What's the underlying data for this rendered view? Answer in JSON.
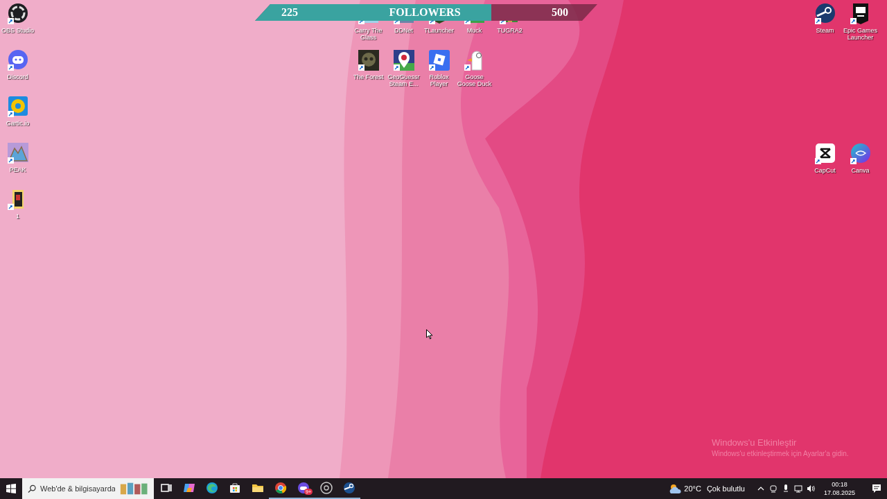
{
  "desktop": {
    "left_column": [
      {
        "kind": "obs",
        "label": "OBS Studio"
      },
      {
        "kind": "discord",
        "label": "Discord"
      },
      {
        "kind": "gartic",
        "label": "Gartic.io"
      },
      {
        "kind": "peak",
        "label": "PEAK"
      },
      {
        "kind": "folder",
        "label": "1"
      }
    ],
    "top_cluster": [
      {
        "kind": "carry",
        "label": "Carry The Glass"
      },
      {
        "kind": "ddnet",
        "label": "DDNet"
      },
      {
        "kind": "tlauncher",
        "label": "TLauncher"
      },
      {
        "kind": "muck",
        "label": "Muck"
      },
      {
        "kind": "winrar",
        "label": "TUGRA2"
      },
      {
        "kind": "forest",
        "label": "The Forest"
      },
      {
        "kind": "geoguessr",
        "label": "GeoGuessr Steam E..."
      },
      {
        "kind": "roblox",
        "label": "Roblox Player"
      },
      {
        "kind": "goose",
        "label": "Goose Goose Duck"
      }
    ],
    "right_top": [
      {
        "kind": "steam",
        "label": "Steam"
      },
      {
        "kind": "epic",
        "label": "Epic Games Launcher"
      }
    ],
    "right_middle": [
      {
        "kind": "capcut",
        "label": "CapCut"
      },
      {
        "kind": "canva",
        "label": "Canva"
      }
    ],
    "activation_notice": {
      "title": "Windows'u Etkinleştir",
      "text": "Windows'u etkinleştirmek için Ayarlar'a gidin."
    }
  },
  "followers_bar": {
    "current": "225",
    "label": "FOLLOWERS",
    "goal": "500",
    "level": 0.69
  },
  "taskbar": {
    "search": {
      "placeholder": "Web'de & bilgisayarda"
    },
    "apps": [
      {
        "kind": "taskview",
        "running": false
      },
      {
        "kind": "copilot",
        "running": false
      },
      {
        "kind": "edge",
        "running": false
      },
      {
        "kind": "store",
        "running": false
      },
      {
        "kind": "explorer",
        "running": false
      },
      {
        "kind": "chrome",
        "running": true
      },
      {
        "kind": "game",
        "running": true,
        "badge": "9+"
      },
      {
        "kind": "obs",
        "running": true
      },
      {
        "kind": "steam",
        "running": true
      }
    ],
    "tray": {
      "temperature": "20°C",
      "weather": "Çok bulutlu",
      "time": "00:18",
      "date": "17.08.2025"
    }
  }
}
